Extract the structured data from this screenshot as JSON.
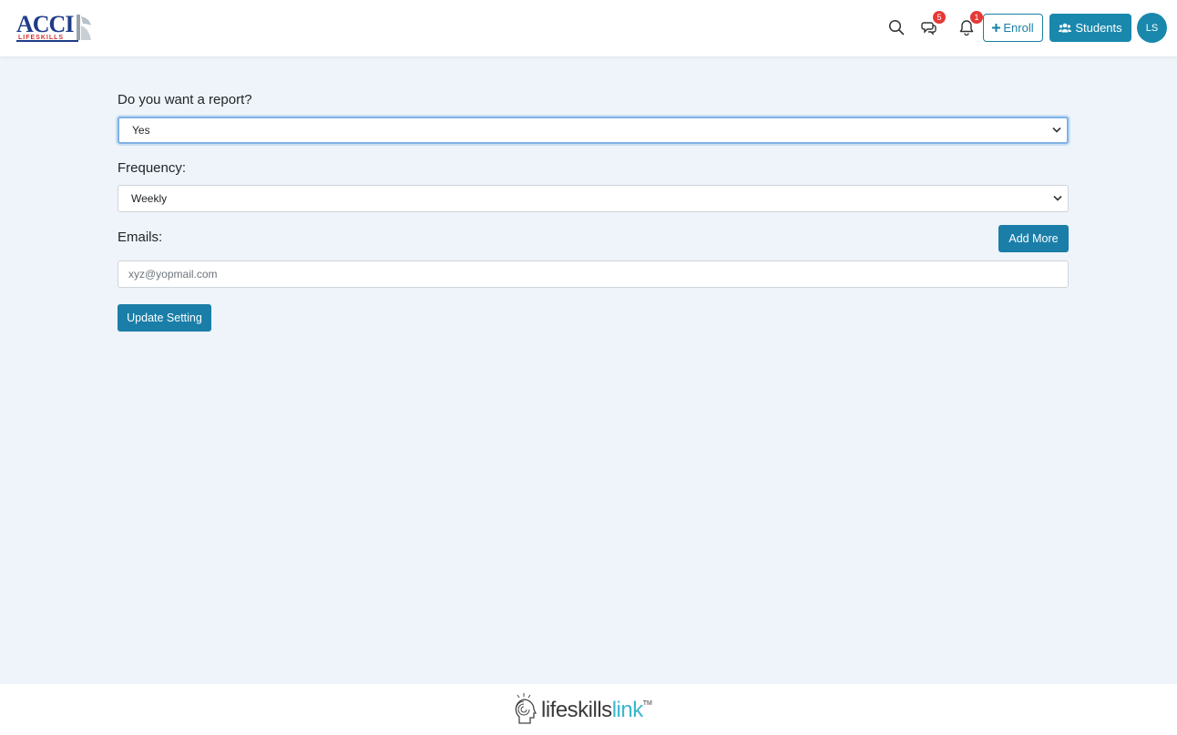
{
  "header": {
    "logo_text": "ACCI",
    "logo_sub": "LIFESKILLS",
    "messages_count": "5",
    "notifications_count": "1",
    "enroll_label": "Enroll",
    "students_label": "Students",
    "avatar_initials": "LS"
  },
  "form": {
    "report_label": "Do you want a report?",
    "report_value": "Yes",
    "frequency_label": "Frequency:",
    "frequency_value": "Weekly",
    "emails_label": "Emails:",
    "add_more_label": "Add More",
    "email_placeholder": "xyz@yopmail.com",
    "update_label": "Update Setting"
  },
  "footer": {
    "brand_part1": "lifeskills",
    "brand_part2": "link",
    "trademark": "TM"
  },
  "colors": {
    "accent": "#1a88ad",
    "badge": "#e53935",
    "background": "#eef4f9"
  }
}
